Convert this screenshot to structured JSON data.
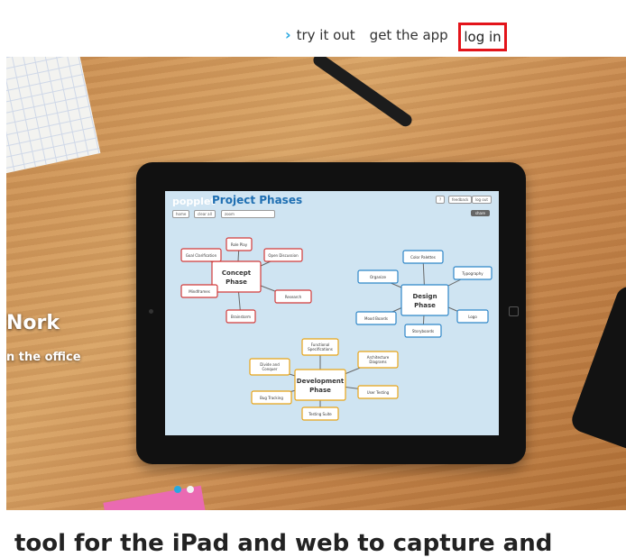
{
  "nav": {
    "items": [
      {
        "label": "try it out"
      },
      {
        "label": "get the app"
      }
    ],
    "login_label": "log in"
  },
  "hero": {
    "heading": "Nork",
    "subtext": "n the office",
    "app": {
      "logo": "popplet",
      "title": "Project Phases",
      "buttons": [
        "home",
        "clear all",
        "zoom"
      ],
      "top_right": [
        "?",
        "feedback",
        "log out"
      ],
      "share": "share"
    },
    "slider": {
      "count": 2,
      "active_index": 0
    }
  },
  "tagline": "tool for the iPad and web to capture and",
  "colors": {
    "accent": "#29a8e0",
    "highlight": "#e3141a"
  }
}
